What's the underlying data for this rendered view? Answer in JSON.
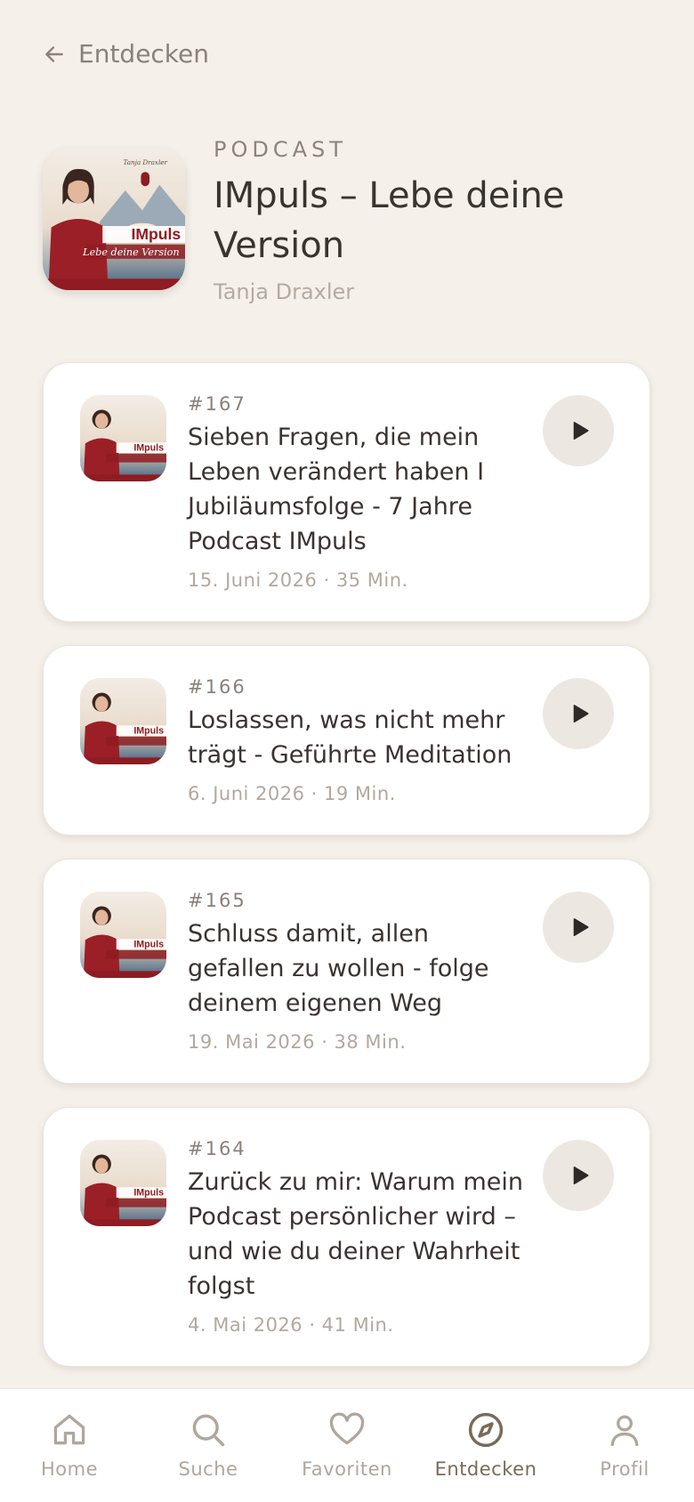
{
  "nav": {
    "back_label": "Entdecken"
  },
  "podcast": {
    "kicker": "PODCAST",
    "title": "IMpuls – Lebe deine Version",
    "author": "Tanja Draxler",
    "cover": {
      "author_signature": "Tanja Draxler",
      "brand": "IMpuls",
      "tagline": "Lebe deine Version"
    }
  },
  "episodes": [
    {
      "number": "#167",
      "title": "Sieben Fragen, die mein Leben verändert haben I Jubiläumsfolge - 7 Jahre Podcast IMpuls",
      "meta": "15. Juni 2026 · 35 Min."
    },
    {
      "number": "#166",
      "title": "Loslassen, was nicht mehr trägt - Geführte Meditation",
      "meta": "6. Juni 2026 · 19 Min."
    },
    {
      "number": "#165",
      "title": "Schluss damit, allen gefallen zu wollen - folge deinem eigenen Weg",
      "meta": "19. Mai 2026 · 38 Min."
    },
    {
      "number": "#164",
      "title": "Zurück zu mir: Warum mein Podcast persönlicher wird – und wie du deiner Wahrheit folgst",
      "meta": "4. Mai 2026 · 41 Min."
    }
  ],
  "tabbar": {
    "active": "Entdecken",
    "items": [
      {
        "label": "Home",
        "icon": "home-icon"
      },
      {
        "label": "Suche",
        "icon": "search-icon"
      },
      {
        "label": "Favoriten",
        "icon": "heart-icon"
      },
      {
        "label": "Entdecken",
        "icon": "compass-icon"
      },
      {
        "label": "Profil",
        "icon": "person-icon"
      }
    ]
  },
  "colors": {
    "background": "#f5f0ea",
    "card": "#ffffff",
    "accent": "#7a6a58",
    "muted": "#b0a69c",
    "cover_red": "#8e1c22"
  }
}
